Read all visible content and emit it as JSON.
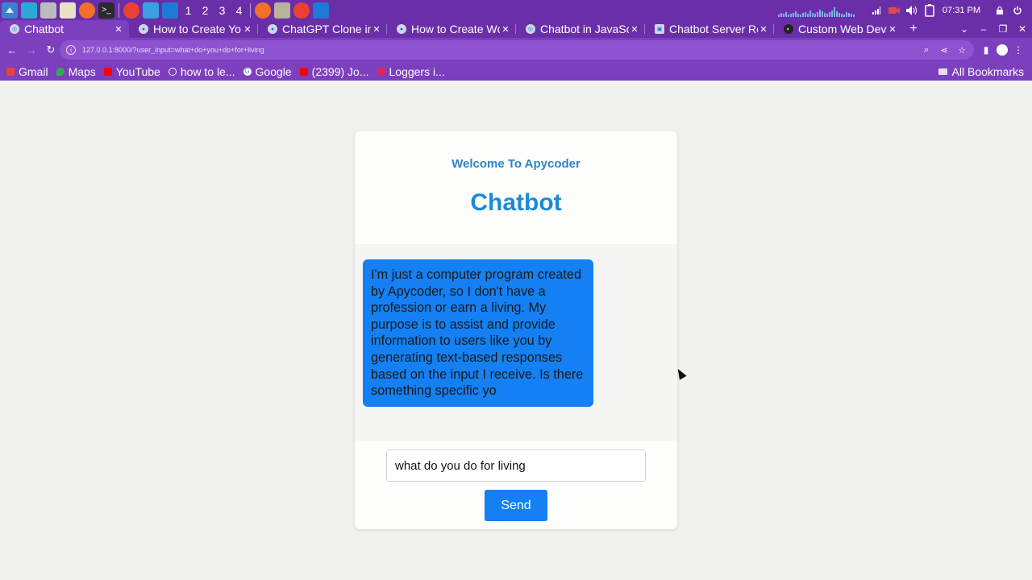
{
  "taskbar": {
    "workspaces": [
      "1",
      "2",
      "3",
      "4"
    ],
    "clock": "07:31 PM"
  },
  "browser": {
    "tabs": [
      {
        "title": "Chatbot",
        "active": true
      },
      {
        "title": "How to Create Yo",
        "active": false
      },
      {
        "title": "ChatGPT Clone in",
        "active": false
      },
      {
        "title": "How to Create Wc",
        "active": false
      },
      {
        "title": "Chatbot in JavaSc",
        "active": false
      },
      {
        "title": "Chatbot Server Re",
        "active": false
      },
      {
        "title": "Custom Web Dev",
        "active": false
      }
    ],
    "new_tab": "+",
    "url": "127.0.0.1:8000/?user_input=what+do+you+do+for+living",
    "bookmarks": [
      "Gmail",
      "Maps",
      "YouTube",
      "how to le...",
      "Google",
      "(2399) Jo...",
      "Loggers i..."
    ],
    "all_bookmarks": "All Bookmarks"
  },
  "page": {
    "welcome": "Welcome To Apycoder",
    "title": "Chatbot",
    "bot_message": "I'm just a computer program created by Apycoder, so I don't have a profession or earn a living. My purpose is to assist and provide information to users like you by generating text-based responses based on the input I receive. Is there something specific yo",
    "input_value": "what do you do for living",
    "send_label": "Send"
  },
  "colors": {
    "chrome": "#7c3fbe",
    "taskbar": "#6a2fa8",
    "accent": "#1480f3",
    "title": "#1b8ad8"
  }
}
